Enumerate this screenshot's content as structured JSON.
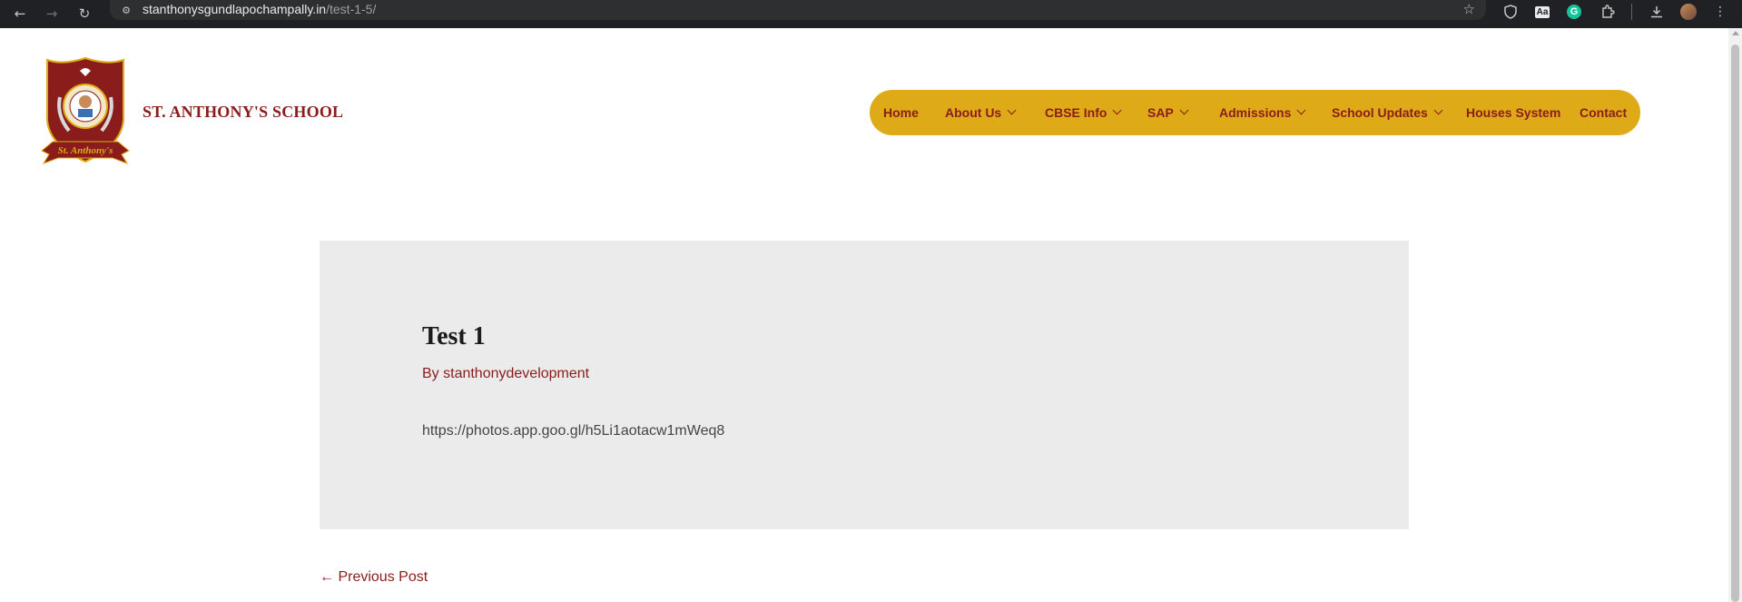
{
  "browser": {
    "url_host": "stanthonysgundlapochampally.in",
    "url_path": "/test-1-5/",
    "extension_aa_label": "Aa",
    "extension_grammarly_label": "G"
  },
  "header": {
    "site_title": "ST. ANTHONY'S SCHOOL",
    "logo_ribbon_text": "St. Anthony's"
  },
  "nav": {
    "items": [
      {
        "label": "Home",
        "has_dropdown": false
      },
      {
        "label": "About Us",
        "has_dropdown": true
      },
      {
        "label": "CBSE Info",
        "has_dropdown": true
      },
      {
        "label": "SAP",
        "has_dropdown": true
      },
      {
        "label": "Admissions",
        "has_dropdown": true
      },
      {
        "label": "School Updates",
        "has_dropdown": true
      },
      {
        "label": "Houses System",
        "has_dropdown": false
      },
      {
        "label": "Contact",
        "has_dropdown": false
      }
    ]
  },
  "post": {
    "title": "Test 1",
    "byline": "By stanthonydevelopment",
    "body": "https://photos.app.goo.gl/h5Li1aotacw1mWeq8"
  },
  "post_nav": {
    "previous_label": "← Previous Post"
  },
  "colors": {
    "brand_maroon": "#8b1c1c",
    "nav_gold": "#dfaa18",
    "article_bg": "#ebebeb"
  }
}
